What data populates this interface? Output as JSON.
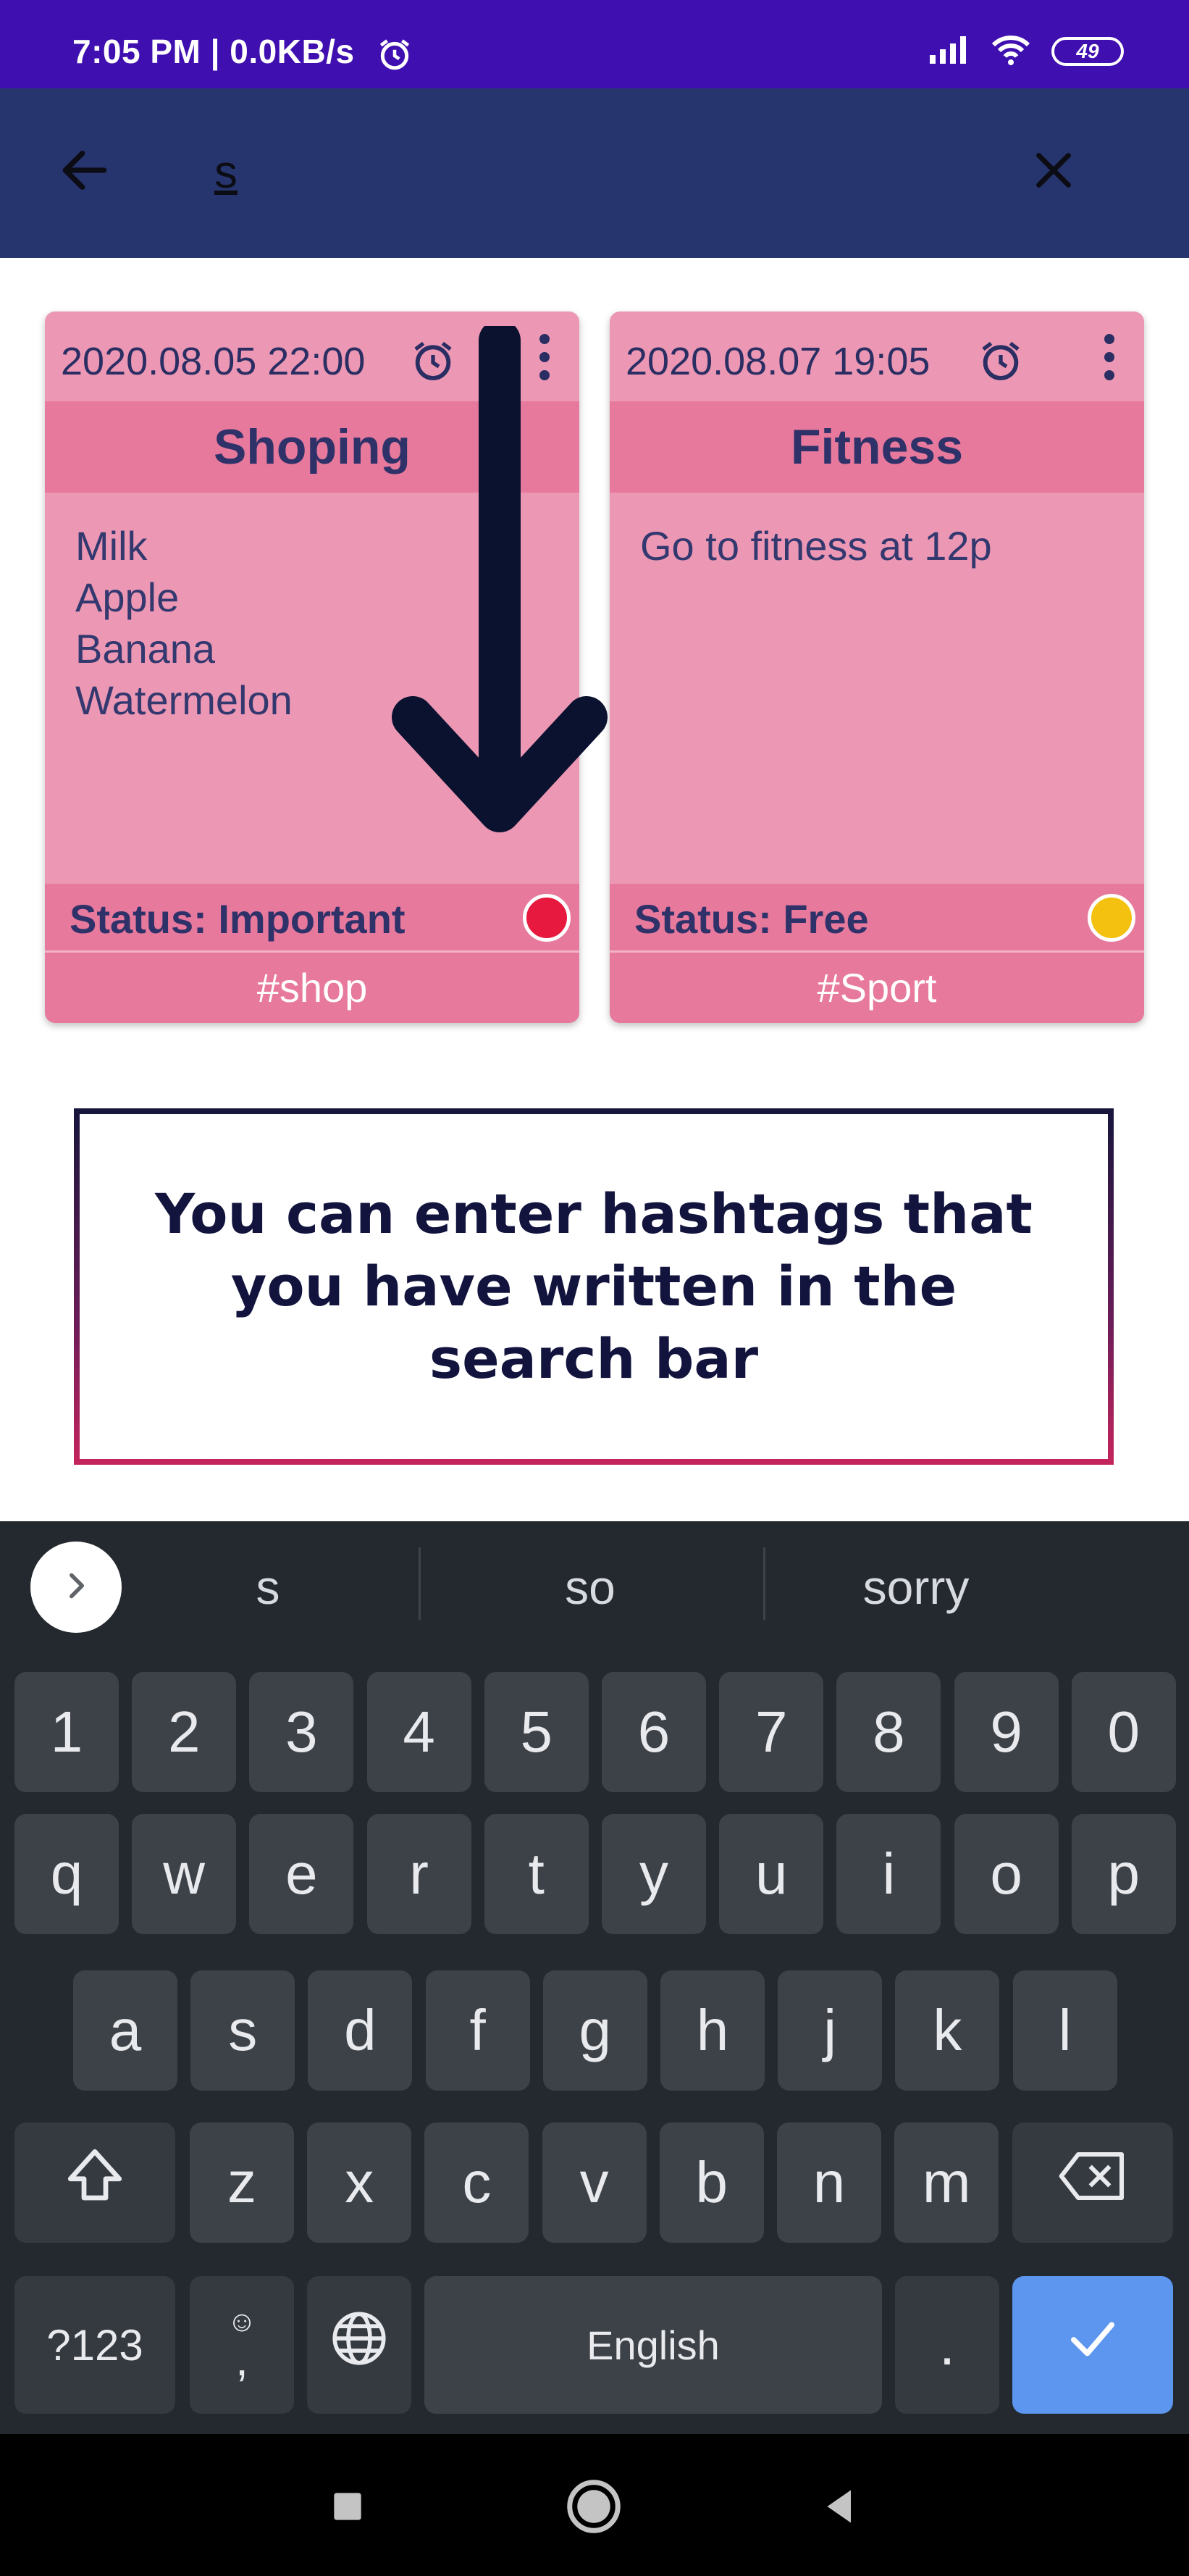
{
  "status_bar": {
    "time": "7:05 PM | 0.0KB/s",
    "battery": "49",
    "background": "#3f0fb0"
  },
  "app_bar": {
    "back_icon": "arrow-back-icon",
    "search_value": "s",
    "clear_icon": "close-icon",
    "background": "#27356e"
  },
  "notes": [
    {
      "date": "2020.08.05 22:00",
      "title": "Shoping",
      "body": "Milk\nApple\nBanana\nWatermelon",
      "status": "Status: Important",
      "status_color": "#e8193f",
      "tag": "#shop"
    },
    {
      "date": "2020.08.07 19:05",
      "title": "Fitness",
      "body": "Go to fitness at 12p",
      "status": "Status: Free",
      "status_color": "#f4c110",
      "tag": "#Sport"
    }
  ],
  "callout": {
    "text": "You can enter hashtags that you have written in the search bar"
  },
  "keyboard": {
    "suggestions": [
      "s",
      "so",
      "sorry"
    ],
    "row_numbers": [
      "1",
      "2",
      "3",
      "4",
      "5",
      "6",
      "7",
      "8",
      "9",
      "0"
    ],
    "row_top": [
      "q",
      "w",
      "e",
      "r",
      "t",
      "y",
      "u",
      "i",
      "o",
      "p"
    ],
    "row_middle": [
      "a",
      "s",
      "d",
      "f",
      "g",
      "h",
      "j",
      "k",
      "l"
    ],
    "row_bottom": [
      "z",
      "x",
      "c",
      "v",
      "b",
      "n",
      "m"
    ],
    "symbols_label": "?123",
    "comma_label": ",",
    "space_label": "English",
    "period_label": ".",
    "enter_color": "#5d96ef"
  },
  "nav_bar": {
    "icons": [
      "recents-square-icon",
      "home-circle-icon",
      "back-triangle-icon"
    ]
  }
}
